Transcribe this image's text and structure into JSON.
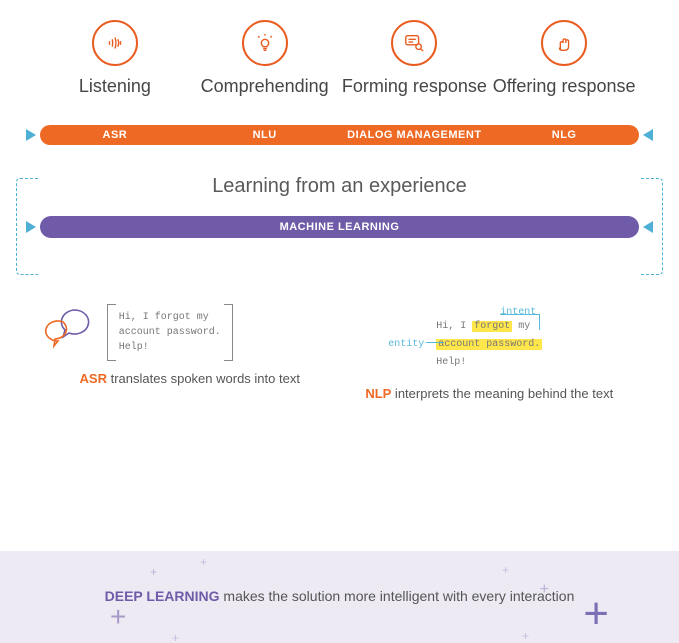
{
  "stages": [
    {
      "label": "Listening",
      "icon": "sound-icon"
    },
    {
      "label": "Comprehending",
      "icon": "lightbulb-icon"
    },
    {
      "label": "Forming response",
      "icon": "dialog-search-icon"
    },
    {
      "label": "Offering response",
      "icon": "hand-icon"
    }
  ],
  "orange_bar": {
    "items": [
      "ASR",
      "NLU",
      "DIALOG MANAGEMENT",
      "NLG"
    ]
  },
  "learning_text": "Learning from an experience",
  "purple_bar": {
    "label": "MACHINE LEARNING"
  },
  "example_asr": {
    "sample_lines": [
      "Hi, I forgot my",
      "account password.",
      "Help!"
    ],
    "caption_bold": "ASR",
    "caption_rest": " translates spoken words into text"
  },
  "example_nlp": {
    "intent_label": "intent",
    "entity_label": "entity",
    "line1_prefix": "Hi, I ",
    "line1_highlight": "forgot",
    "line1_suffix": " my",
    "line2_highlight": "account password.",
    "line3": "Help!",
    "caption_bold": "NLP",
    "caption_rest": " interprets the meaning behind the text"
  },
  "banner": {
    "bold": "DEEP LEARNING",
    "rest": " makes the solution more intelligent with every interaction"
  }
}
